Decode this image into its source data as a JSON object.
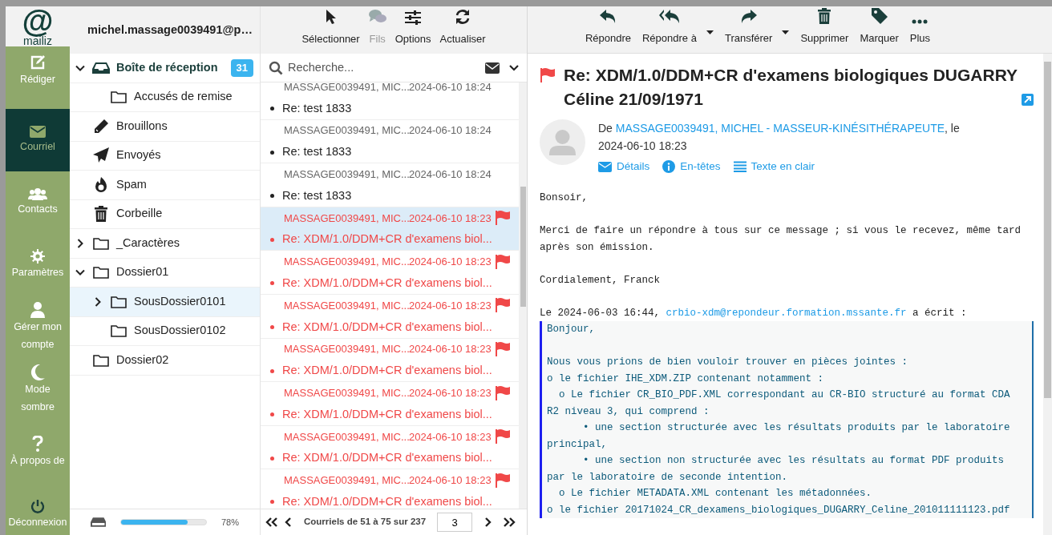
{
  "logo": {
    "symbol": "@",
    "name": "mailiz"
  },
  "account": "michel.massage0039491@p…",
  "nav": [
    {
      "kind": "compose",
      "label": "Rédiger",
      "selected": false
    },
    {
      "kind": "mail",
      "label": "Courriel",
      "selected": true
    },
    {
      "kind": "contacts",
      "label": "Contacts",
      "selected": false
    },
    {
      "kind": "settings",
      "label": "Paramètres",
      "selected": false
    },
    {
      "kind": "account",
      "label": "Gérer mon compte",
      "selected": false
    },
    {
      "kind": "dark",
      "label": "Mode sombre",
      "selected": false
    },
    {
      "kind": "about",
      "label": "À propos de",
      "selected": false
    },
    {
      "kind": "logout",
      "label": "Déconnexion",
      "selected": false
    }
  ],
  "folders": [
    {
      "kind": "inbox",
      "name": "Boîte de réception",
      "count": "31",
      "expanded": true,
      "selected": false,
      "children": [
        {
          "kind": "folder",
          "name": "Accusés de remise",
          "selected": false
        }
      ]
    },
    {
      "kind": "drafts",
      "name": "Brouillons",
      "selected": false
    },
    {
      "kind": "sent",
      "name": "Envoyés",
      "selected": false
    },
    {
      "kind": "spam",
      "name": "Spam",
      "selected": false
    },
    {
      "kind": "trash",
      "name": "Corbeille",
      "selected": false
    },
    {
      "kind": "folder",
      "name": "_Caractères",
      "expanded": false,
      "selected": false
    },
    {
      "kind": "folder",
      "name": "Dossier01",
      "expanded": true,
      "selected": false,
      "children": [
        {
          "kind": "folder",
          "name": "SousDossier0101",
          "expanded": false,
          "selected": true
        },
        {
          "kind": "folder",
          "name": "SousDossier0102",
          "selected": false
        }
      ]
    },
    {
      "kind": "folder",
      "name": "Dossier02",
      "selected": false
    }
  ],
  "storage": {
    "level": 0.78,
    "reading": "78%"
  },
  "list_toolbar": [
    {
      "kind": "select",
      "label": "Sélectionner",
      "disabled": false
    },
    {
      "kind": "threads",
      "label": "Fils",
      "disabled": true
    },
    {
      "kind": "options",
      "label": "Options",
      "disabled": false
    },
    {
      "kind": "refresh",
      "label": "Actualiser",
      "disabled": false
    }
  ],
  "search": {
    "placeholder": "Recherche..."
  },
  "messages": [
    {
      "sender": "MASSAGE0039491, MIC...",
      "date": "2024-06-10 18:24",
      "subject": "Re: test 1833",
      "flagged": false,
      "selected": false
    },
    {
      "sender": "MASSAGE0039491, MIC...",
      "date": "2024-06-10 18:24",
      "subject": "Re: test 1833",
      "flagged": false,
      "selected": false
    },
    {
      "sender": "MASSAGE0039491, MIC...",
      "date": "2024-06-10 18:24",
      "subject": "Re: test 1833",
      "flagged": false,
      "selected": false
    },
    {
      "sender": "MASSAGE0039491, MIC...",
      "date": "2024-06-10 18:23",
      "subject": "Re: XDM/1.0/DDM+CR d'examens biol...",
      "flagged": true,
      "selected": true
    },
    {
      "sender": "MASSAGE0039491, MIC...",
      "date": "2024-06-10 18:23",
      "subject": "Re: XDM/1.0/DDM+CR d'examens biol...",
      "flagged": true,
      "selected": false
    },
    {
      "sender": "MASSAGE0039491, MIC...",
      "date": "2024-06-10 18:23",
      "subject": "Re: XDM/1.0/DDM+CR d'examens biol...",
      "flagged": true,
      "selected": false
    },
    {
      "sender": "MASSAGE0039491, MIC...",
      "date": "2024-06-10 18:23",
      "subject": "Re: XDM/1.0/DDM+CR d'examens biol...",
      "flagged": true,
      "selected": false
    },
    {
      "sender": "MASSAGE0039491, MIC...",
      "date": "2024-06-10 18:23",
      "subject": "Re: XDM/1.0/DDM+CR d'examens biol...",
      "flagged": true,
      "selected": false
    },
    {
      "sender": "MASSAGE0039491, MIC...",
      "date": "2024-06-10 18:23",
      "subject": "Re: XDM/1.0/DDM+CR d'examens biol...",
      "flagged": true,
      "selected": false
    },
    {
      "sender": "MASSAGE0039491, MIC...",
      "date": "2024-06-10 18:23",
      "subject": "Re: XDM/1.0/DDM+CR d'examens biol...",
      "flagged": true,
      "selected": false
    }
  ],
  "pager": {
    "summary": "Courriels de 51 à 75 sur 237",
    "page": "3"
  },
  "reader_toolbar": [
    {
      "kind": "reply",
      "label": "Répondre",
      "dropdown": false
    },
    {
      "kind": "reply_all",
      "label": "Répondre à",
      "dropdown": true
    },
    {
      "kind": "forward",
      "label": "Transférer",
      "dropdown": true
    },
    {
      "kind": "delete",
      "label": "Supprimer",
      "dropdown": false
    },
    {
      "kind": "tag",
      "label": "Marquer",
      "dropdown": false
    },
    {
      "kind": "more",
      "label": "Plus",
      "dropdown": false
    }
  ],
  "message": {
    "flagged": true,
    "subject": "Re: XDM/1.0/DDM+CR d'examens biologiques DUGARRY Céline 21/09/1971",
    "from_prefix": "De ",
    "from": "MASSAGE0039491, MICHEL - MASSEUR-KINÉSITHÉRAPEUTE",
    "from_suffix": ", le",
    "date": "2024-06-10 18:23",
    "links": [
      {
        "kind": "details",
        "label": "Détails"
      },
      {
        "kind": "headers",
        "label": "En-têtes"
      },
      {
        "kind": "plain",
        "label": "Texte en clair"
      }
    ],
    "body": [
      {
        "kind": "text",
        "text": "Bonsoir,"
      },
      {
        "kind": "text",
        "text": "Merci de faire un répondre à tous sur ce message ; si vous le recevez, même tard après son émission."
      },
      {
        "kind": "text",
        "text": "Cordialement, Franck"
      },
      {
        "kind": "quote_header",
        "prefix": "Le 2024-06-03 16:44, ",
        "link": "crbio-xdm@repondeur.formation.mssante.fr",
        "suffix": " a écrit :"
      },
      {
        "kind": "quote",
        "text": "Bonjour,\n\nNous vous prions de bien vouloir trouver en pièces jointes :\no le fichier IHE_XDM.ZIP contenant notamment :\n  o Le fichier CR_BIO_PDF.XML correspondant au CR-BIO structuré au format CDA R2 niveau 3, qui comprend :\n      • une section structurée avec les résultats produits par le laboratoire principal,\n      • une section non structurée avec les résultats au format PDF produits par le laboratoire de seconde intention.\n  o Le fichier METADATA.XML contenant les métadonnées.\no le fichier 20171024_CR_dexamens_biologiques_DUGARRY_Celine_201011111123.pdf"
      }
    ]
  }
}
